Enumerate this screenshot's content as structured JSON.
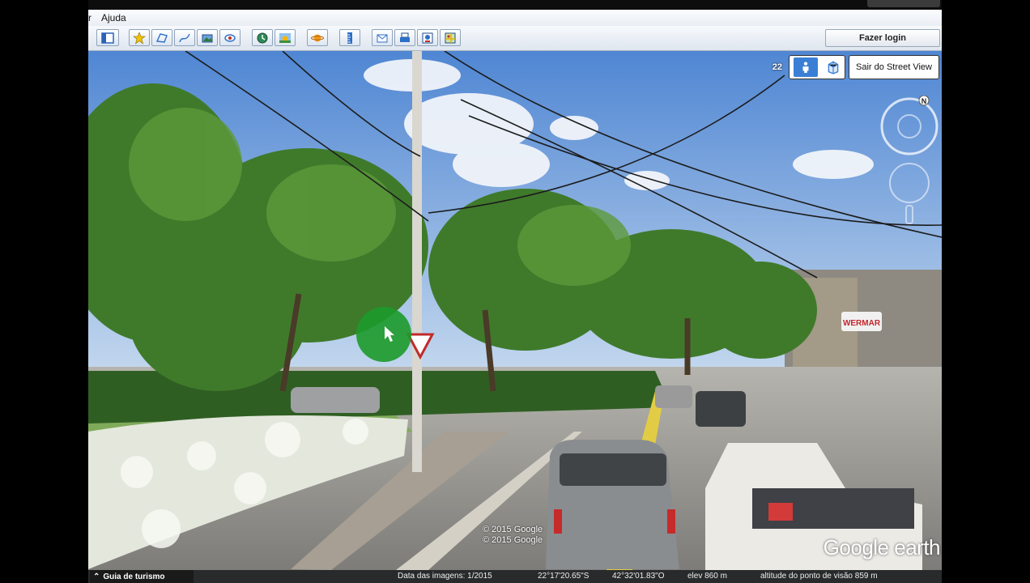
{
  "menu": {
    "partial_item": "r",
    "help": "Ajuda"
  },
  "toolbar": {
    "login_label": "Fazer login",
    "icons": [
      "sidebar-icon",
      "placemark-icon",
      "polygon-icon",
      "path-icon",
      "image-overlay-icon",
      "record-tour-icon",
      "historical-imagery-icon",
      "sunlight-icon",
      "planets-icon",
      "ruler-icon",
      "email-icon",
      "print-icon",
      "save-image-icon",
      "view-in-maps-icon"
    ]
  },
  "street_view": {
    "zoom_value": "22",
    "exit_label": "Sair do Street View",
    "compass_north": "N"
  },
  "scene": {
    "store_sign": "WERMAR"
  },
  "overlay": {
    "copyright_1": "© 2015 Google",
    "copyright_2": "© 2015 Google",
    "watermark": "Google earth"
  },
  "status": {
    "tour_guide": "Guia de turismo",
    "image_date": "Data das imagens: 1/2015",
    "latitude": "22°17'20.65\"S",
    "longitude": "42°32'01.83\"O",
    "elevation": "elev  860 m",
    "eye_alt": "altitude do ponto de visão  859 m"
  },
  "colors": {
    "accent_blue": "#3a7fd5",
    "street_line": "#e8d24a",
    "cursor_green": "#1c9a2a"
  }
}
